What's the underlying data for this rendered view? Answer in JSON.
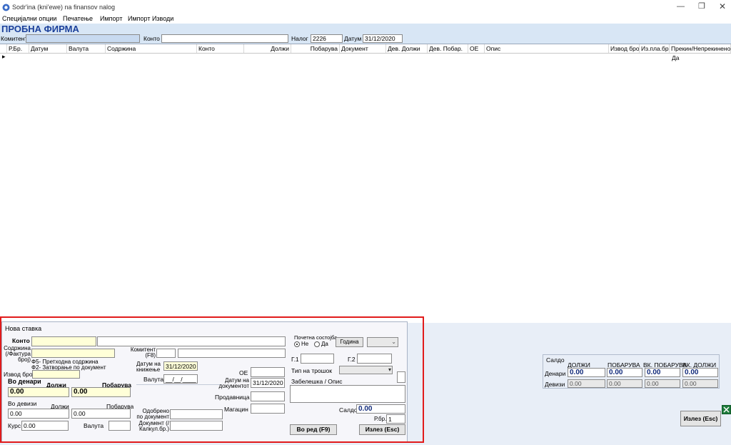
{
  "window": {
    "title": "Sodr'ina (kni'ewe) na finansov nalog"
  },
  "menu": [
    "Специјални опции",
    "Печатење",
    "Импорт",
    "Импорт Изводи"
  ],
  "firm": {
    "name": "ПРОБНА ФИРМА"
  },
  "filter": {
    "komitent_label": "Комитент",
    "konto_label": "Конто",
    "nalog_label": "Налог",
    "nalog_value": "2226",
    "datum_label": "Датум",
    "datum_value": "31/12/2020"
  },
  "grid": {
    "columns": [
      "Р.Бр.",
      "Датум",
      "Валута",
      "Содржина",
      "Конто",
      "Должи",
      "Побарува",
      "Документ",
      "Дев. Должи",
      "Дев. Побар.",
      "ОЕ",
      "Опис",
      "Извод број",
      "Из.пла.бр.",
      "Прекин/Непрекинено"
    ],
    "row_marker": "▸",
    "row_last_value": "Да"
  },
  "dialog": {
    "title": "Нова ставка",
    "konto_label": "Конто",
    "soderzina_label": "Содржина (/Фактура број)",
    "hint_f5": "Ф5- Претходна содржина",
    "hint_f2": "Ф2- Затворање по документ",
    "izvod_label": "Извод број",
    "vo_denari": "Во денари",
    "dolzi_label": "Должи",
    "pobaruva_label": "Побарува",
    "dolzi_value": "0.00",
    "pobaruva_value": "0.00",
    "vo_devizi": "Во девизи",
    "dev_dolzi_label": "Должи",
    "dev_pobaruva_label": "Побарува",
    "dev_dolzi_value": "0.00",
    "dev_pobaruva_value": "0.00",
    "kurs_label": "Курс",
    "kurs_value": "0.00",
    "valuta_label": "Валута",
    "komitent_label": "Комитент (F8)",
    "datum_kniz_label": "Датум на книжење",
    "datum_kniz_value": "31/12/2020",
    "valuta2_label": "Валута",
    "valuta2_value": "__/__/____",
    "oe_label": "ОЕ",
    "datum_dok_label": "Датум на документот",
    "datum_dok_value": "31/12/2020",
    "prodavnica_label": "Продавница",
    "magacin_label": "Магацин",
    "odobreno_label": "Одобрено по документ",
    "dokument_label": "Документ (/Калкул.бр.)",
    "pocetna_label": "Почетна состојба",
    "ne_label": "Не",
    "da_label": "Да",
    "godina_button": "Година",
    "g1_label": "Г.1",
    "g2_label": "Г.2",
    "tip_label": "Тип на трошок",
    "zabeleska_label": "Забелешка / Опис",
    "saldo_label": "Салдо",
    "saldo_value": "0.00",
    "rbr_label": "Р.бр.",
    "rbr_value": "1",
    "vo_red_button": "Во ред (F9)",
    "izlez_button": "Излез (Esc)"
  },
  "summary": {
    "saldo_label": "Салдо",
    "headers": [
      "ДОЛЖИ",
      "ПОБАРУВА",
      "ВК. ПОБАРУВА",
      "ВК. ДОЛЖИ"
    ],
    "denari_label": "Денари",
    "devizi_label": "Девизи",
    "denari": [
      "0.00",
      "0.00",
      "0.00",
      "0.00"
    ],
    "devizi": [
      "0.00",
      "0.00",
      "0.00",
      "0.00"
    ]
  },
  "main_exit_button": "Излез (Esc)"
}
